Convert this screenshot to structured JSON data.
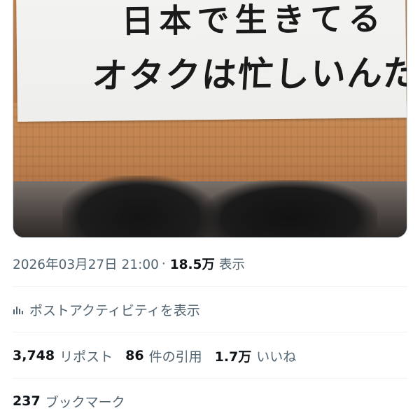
{
  "photo": {
    "sign_line1": "日本で生きてる",
    "sign_line2": "オタクは忙しいんだ。"
  },
  "meta": {
    "timestamp": "2026年03月27日 21:00",
    "separator": "·",
    "views_count": "18.5万",
    "views_label": "表示"
  },
  "activity": {
    "icon": "bar-chart-icon",
    "label": "ポストアクティビティを表示"
  },
  "stats": {
    "reposts_count": "3,748",
    "reposts_label": "リポスト",
    "quotes_count": "86",
    "quotes_label": "件の引用",
    "likes_count": "1.7万",
    "likes_label": "いいね"
  },
  "bookmarks": {
    "count": "237",
    "label": "ブックマーク"
  },
  "colors": {
    "text_primary": "#0f1419",
    "text_secondary": "#536471",
    "divider": "#eff3f4"
  }
}
